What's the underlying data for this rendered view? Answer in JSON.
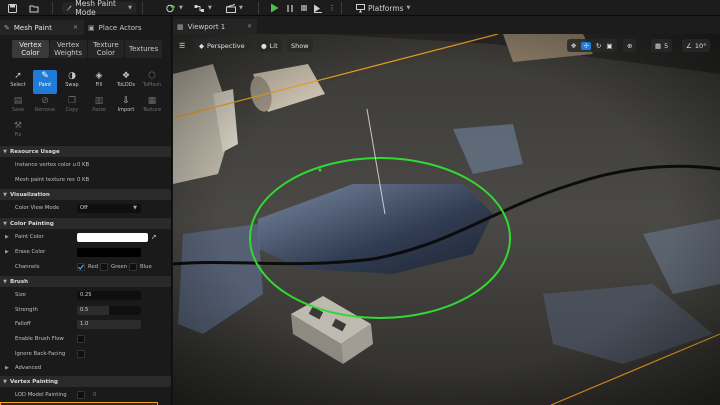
{
  "toolbar": {
    "mode_label": "Mesh Paint Mode",
    "platforms_label": "Platforms"
  },
  "left_tabs": [
    {
      "label": "Mesh Paint",
      "active": true
    },
    {
      "label": "Place Actors",
      "active": false
    }
  ],
  "paint_modes": [
    {
      "label": "Vertex Color",
      "active": true
    },
    {
      "label": "Vertex Weights",
      "active": false
    },
    {
      "label": "Texture Color",
      "active": false
    },
    {
      "label": "Textures",
      "active": false
    }
  ],
  "tools": [
    {
      "label": "Select",
      "icon": "cursor-icon",
      "active": false,
      "enabled": true
    },
    {
      "label": "Paint",
      "icon": "brush-icon",
      "active": true,
      "enabled": true
    },
    {
      "label": "Swap",
      "icon": "swap-icon",
      "active": false,
      "enabled": true
    },
    {
      "label": "Fill",
      "icon": "bucket-icon",
      "active": false,
      "enabled": true
    },
    {
      "label": "ToLODs",
      "icon": "lod-icon",
      "active": false,
      "enabled": true
    },
    {
      "label": "ToMesh",
      "icon": "mesh-icon",
      "active": false,
      "enabled": false
    },
    {
      "label": "Save",
      "icon": "save-icon",
      "active": false,
      "enabled": false
    },
    {
      "label": "Remove",
      "icon": "remove-icon",
      "active": false,
      "enabled": false
    },
    {
      "label": "Copy",
      "icon": "copy-icon",
      "active": false,
      "enabled": false
    },
    {
      "label": "Paste",
      "icon": "paste-icon",
      "active": false,
      "enabled": false
    },
    {
      "label": "Import",
      "icon": "import-icon",
      "active": false,
      "enabled": true
    },
    {
      "label": "Texture",
      "icon": "texture-icon",
      "active": false,
      "enabled": false
    },
    {
      "label": "Fix",
      "icon": "fix-icon",
      "active": false,
      "enabled": false
    }
  ],
  "sections": {
    "resource_usage": {
      "title": "Resource Usage",
      "rows": [
        {
          "label": "Instance vertex color u",
          "value": "0 KB"
        },
        {
          "label": "Mesh paint texture res",
          "value": "0 KB"
        }
      ]
    },
    "visualization": {
      "title": "Visualization",
      "color_view_mode_label": "Color View Mode",
      "color_view_mode_value": "Off"
    },
    "color_painting": {
      "title": "Color Painting",
      "paint_color_label": "Paint Color",
      "paint_color_hex": "#ffffff",
      "erase_color_label": "Erase Color",
      "erase_color_hex": "#000000",
      "channels_label": "Channels",
      "channels": [
        {
          "label": "Red",
          "checked": true
        },
        {
          "label": "Green",
          "checked": false
        },
        {
          "label": "Blue",
          "checked": false
        }
      ]
    },
    "brush": {
      "title": "Brush",
      "size_label": "Size",
      "size_value": "0.25",
      "strength_label": "Strength",
      "strength_value": "0.5",
      "falloff_label": "Falloff",
      "falloff_value": "1.0",
      "flow_label": "Enable Brush Flow",
      "backfacing_label": "Ignore Back-Facing"
    },
    "advanced": {
      "title": "Advanced"
    },
    "vertex_painting": {
      "title": "Vertex Painting",
      "lod_label": "LOD Model Painting",
      "lod_value": "0"
    }
  },
  "viewport": {
    "tab_label": "Viewport 1",
    "perspective_label": "Perspective",
    "lit_label": "Lit",
    "show_label": "Show",
    "snap_value": "5",
    "angle_value": "10°"
  },
  "colors": {
    "accent_blue": "#1f7ad8",
    "brush_ring": "#32d932",
    "selection_outline": "#f2a31e"
  }
}
